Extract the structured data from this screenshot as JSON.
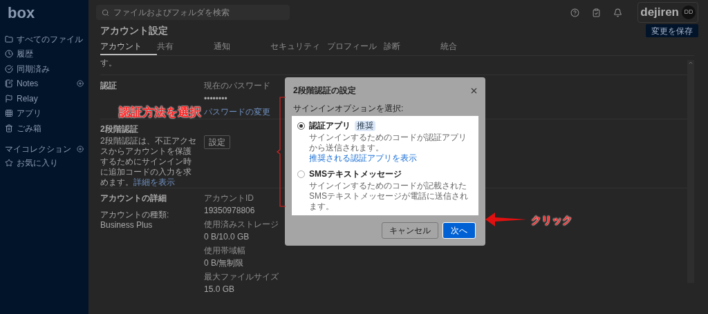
{
  "sidebar": {
    "logo": "box",
    "items": [
      {
        "label": "すべてのファイル",
        "add": false
      },
      {
        "label": "履歴",
        "add": false
      },
      {
        "label": "同期済み",
        "add": false
      },
      {
        "label": "Notes",
        "add": true
      },
      {
        "label": "Relay",
        "add": false
      },
      {
        "label": "アプリ",
        "add": false
      },
      {
        "label": "ごみ箱",
        "add": false
      }
    ],
    "collections": {
      "heading": "マイコレクション",
      "add": true,
      "items": [
        {
          "label": "お気に入り"
        }
      ]
    }
  },
  "topbar": {
    "search": {
      "placeholder": "ファイルおよびフォルダを検索"
    },
    "brand": "dejiren",
    "avatar": "DD"
  },
  "page": {
    "title": "アカウント設定",
    "save_button": "変更を保存",
    "tabs": [
      {
        "label": "アカウント",
        "selected": true
      },
      {
        "label": "共有",
        "selected": false
      },
      {
        "label": "通知",
        "selected": false
      },
      {
        "label": "セキュリティ",
        "selected": false
      },
      {
        "label": "プロフィール",
        "selected": false
      },
      {
        "label": "診断",
        "selected": false
      },
      {
        "label": "統合",
        "selected": false
      }
    ],
    "fragment": "す。",
    "auth": {
      "heading": "認証",
      "password_label": "現在のパスワード",
      "password_value": "••••••••",
      "change_link": "パスワードの変更"
    },
    "two_step": {
      "heading": "2段階認証",
      "description": "2段階認証は、不正アクセスからアカウントを保護するためにサインイン時に追加コードの入力を求めます。",
      "more_link": "詳細を表示",
      "setup_button": "設定"
    },
    "details": {
      "heading": "アカウントの詳細",
      "type": "アカウントの種類: Business Plus",
      "fields": [
        {
          "label": "アカウントID",
          "value": "19350978806"
        },
        {
          "label": "使用済みストレージ",
          "value": "0 B/10.0 GB"
        },
        {
          "label": "使用帯域幅",
          "value": "0 B/無制限"
        },
        {
          "label": "最大ファイルサイズ",
          "value": "15.0 GB"
        }
      ]
    }
  },
  "modal": {
    "title": "2段階認証の設定",
    "prompt": "サインインオプションを選択:",
    "options": [
      {
        "label": "認証アプリ",
        "badge": "推奨",
        "description": "サインインするためのコードが認証アプリから送信されます。",
        "link": "推奨される認証アプリを表示",
        "selected": true
      },
      {
        "label": "SMSテキストメッセージ",
        "description": "サインインするためのコードが記載されたSMSテキストメッセージが電話に送信されます。",
        "selected": false
      }
    ],
    "cancel_button": "キャンセル",
    "next_button": "次へ"
  },
  "annotations": {
    "choose": "認証方法を選択",
    "click": "クリック"
  }
}
